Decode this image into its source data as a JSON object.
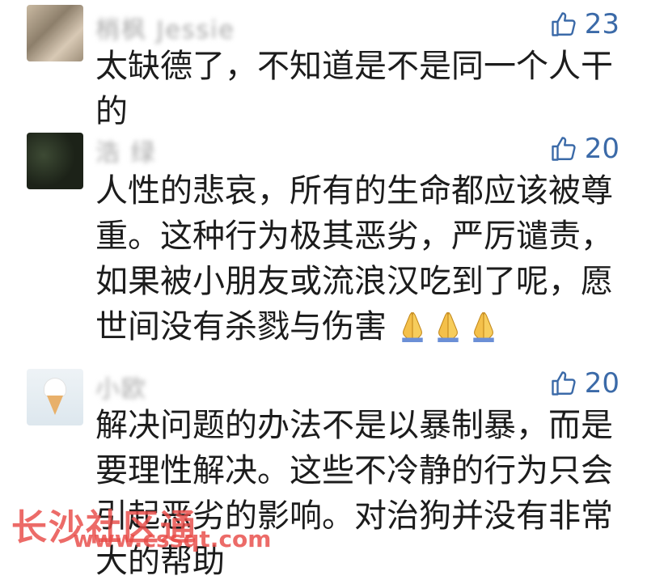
{
  "comments": [
    {
      "name": "梢枫 Jessie",
      "likes": "23",
      "text": "太缺德了，不知道是不是同一个人干的"
    },
    {
      "name": "浩 绿",
      "likes": "20",
      "text": "人性的悲哀，所有的生命都应该被尊重。这种行为极其恶劣，严厉谴责，如果被小朋友或流浪汉吃到了呢，愿世间没有杀戮与伤害"
    },
    {
      "name": "小欧",
      "likes": "20",
      "text": "解决问题的办法不是以暴制暴，而是要理性解决。这些不冷静的行为只会引起恶劣的影响。对治狗并没有非常大的帮助"
    }
  ],
  "icons": {
    "like": "thumbs-up-icon",
    "emoji": "folded-hands-icon"
  },
  "colors": {
    "like": "#3b6aa8",
    "watermark": "#e94b47"
  },
  "watermark": {
    "title": "长沙社区通",
    "url": "www.cssqt.com"
  }
}
